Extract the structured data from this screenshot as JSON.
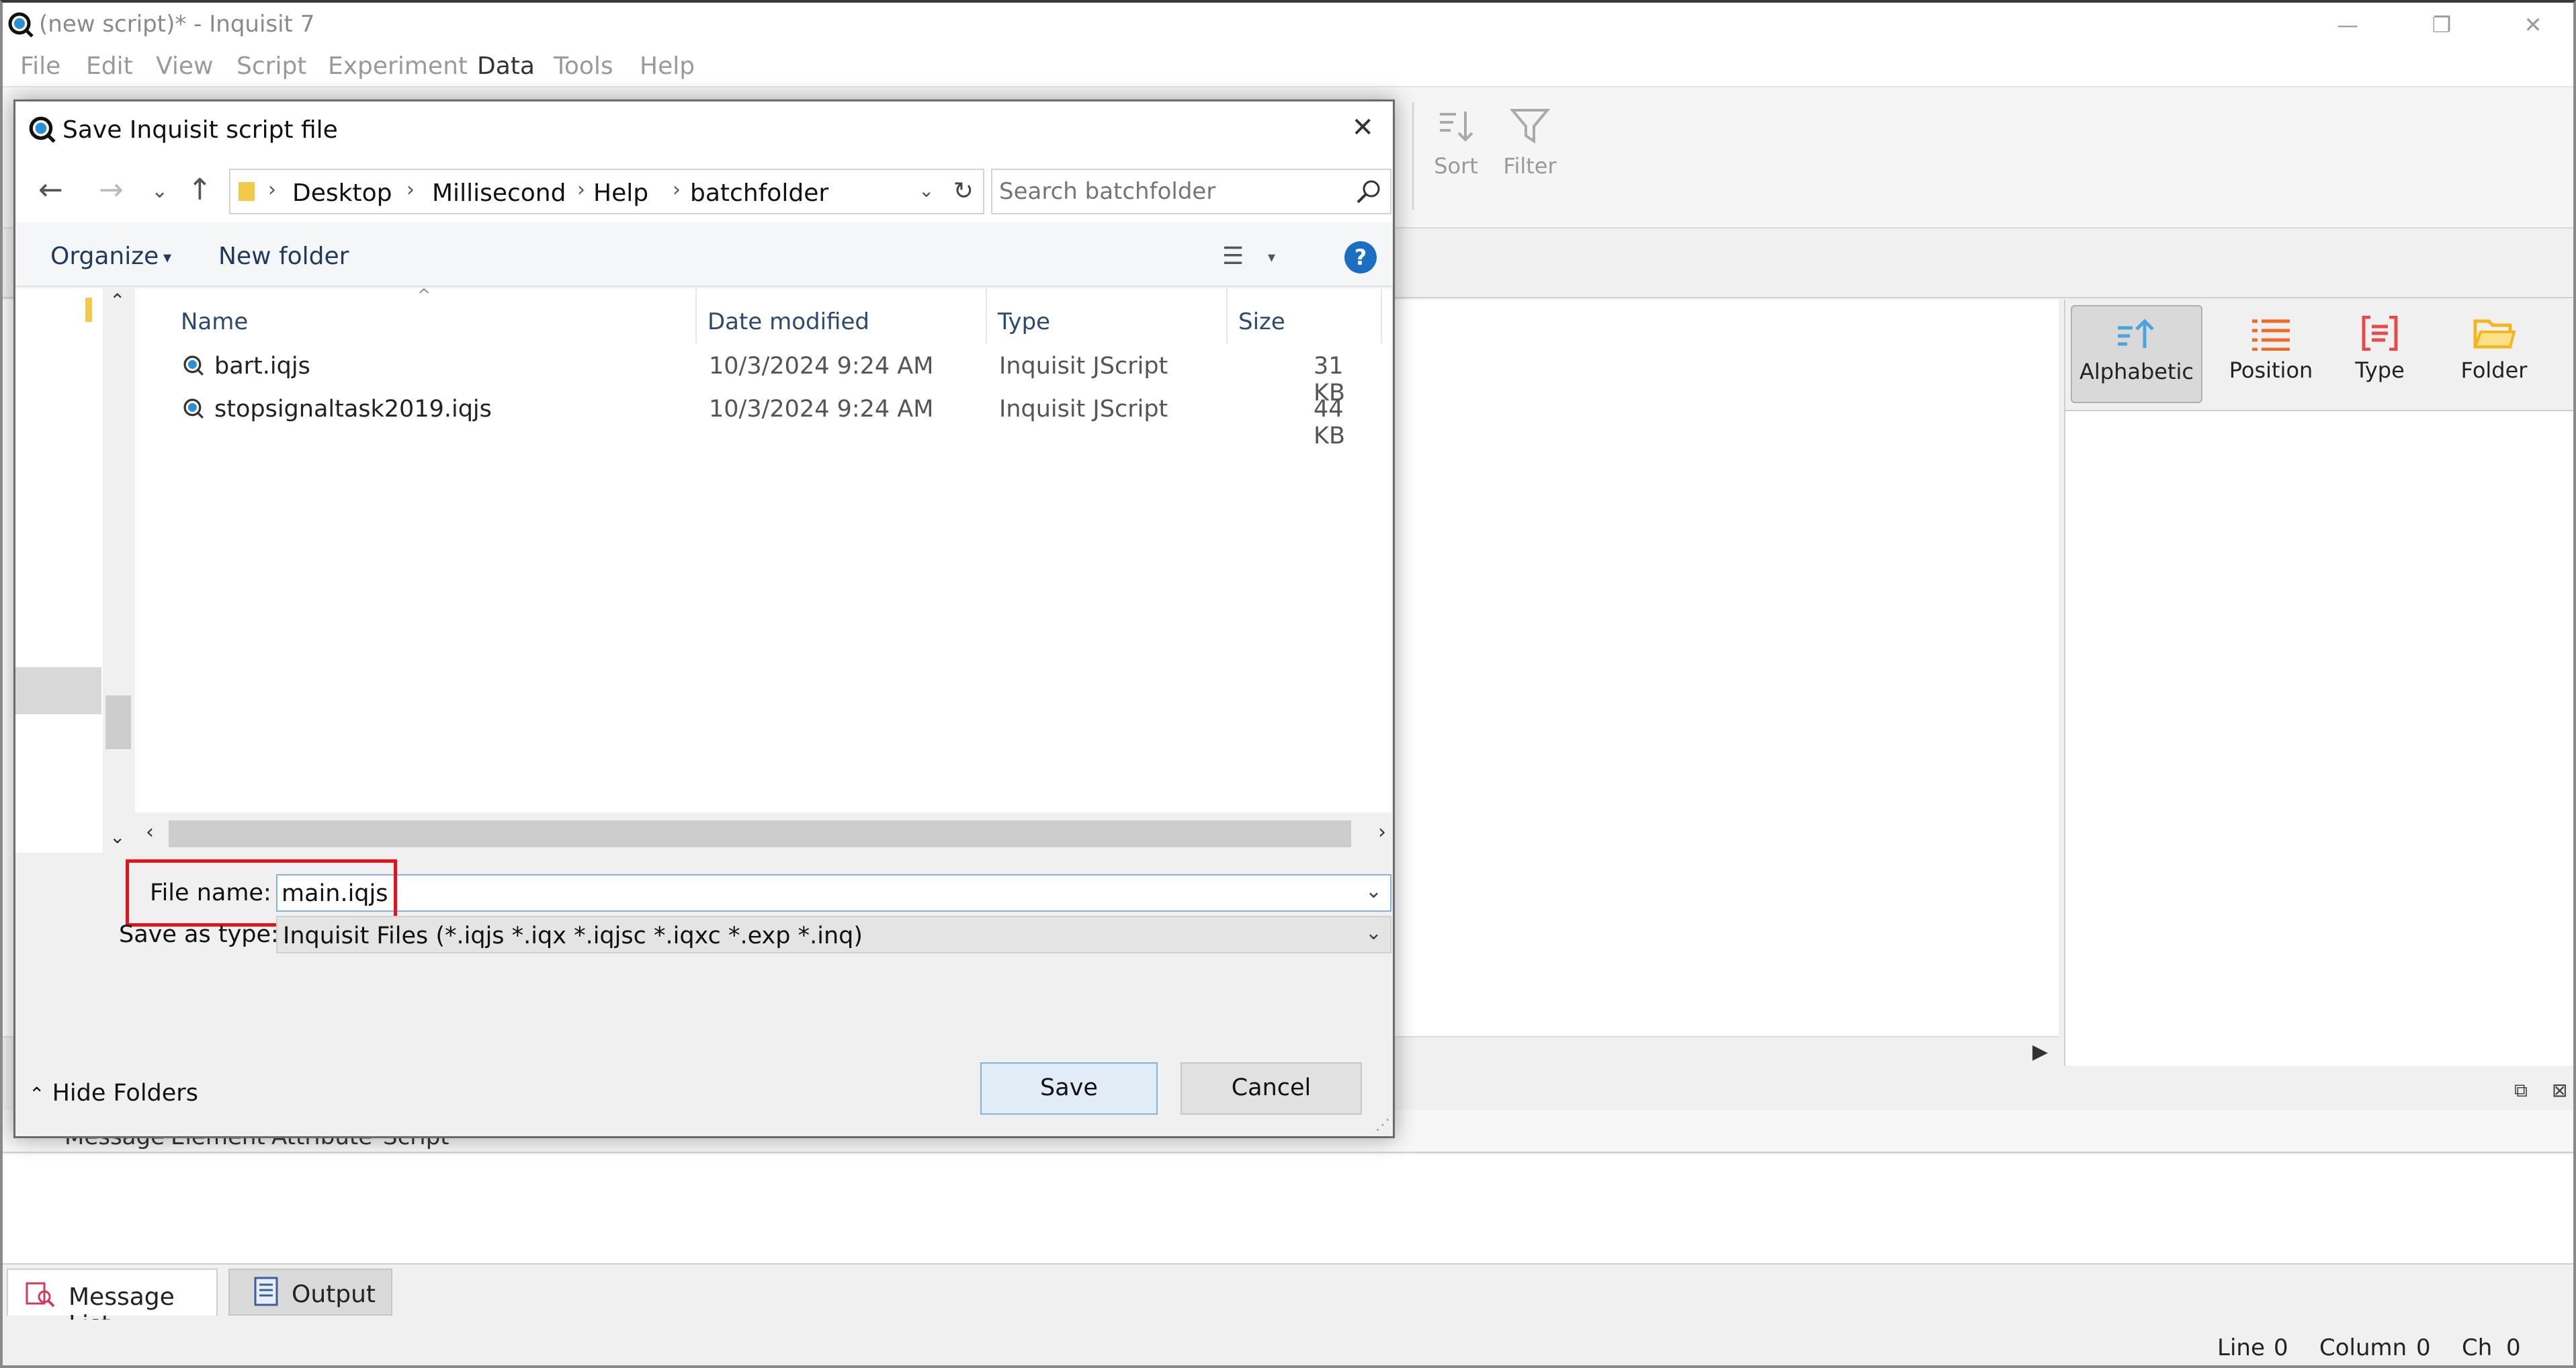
{
  "window": {
    "title": "(new script)* - Inquisit 7",
    "minimize": "—",
    "restore": "❐",
    "close": "✕"
  },
  "menu": [
    "File",
    "Edit",
    "View",
    "Script",
    "Experiment",
    "Data",
    "Tools",
    "Help"
  ],
  "toolbar": {
    "sort": "Sort",
    "filter": "Filter"
  },
  "properties": {
    "alphabetic": "Alphabetic",
    "position": "Position",
    "type": "Type",
    "folder": "Folder"
  },
  "messages": {
    "columns": [
      "Message",
      "Element",
      "Attribute",
      "Script"
    ]
  },
  "bottom_tabs": {
    "message_list": "Message List",
    "output": "Output"
  },
  "status": {
    "line_label": "Line",
    "line": "0",
    "column_label": "Column",
    "column": "0",
    "ch_label": "Ch",
    "ch": "0"
  },
  "dialog": {
    "title": "Save Inquisit script file",
    "close": "✕",
    "breadcrumbs": [
      "Desktop",
      "Millisecond",
      "Help",
      "batchfolder"
    ],
    "search_placeholder": "Search batchfolder",
    "organize": "Organize",
    "new_folder": "New folder",
    "help": "?",
    "columns": {
      "name": "Name",
      "date": "Date modified",
      "type": "Type",
      "size": "Size"
    },
    "files": [
      {
        "name": "bart.iqjs",
        "date": "10/3/2024 9:24 AM",
        "type": "Inquisit JScript",
        "size": "31 KB"
      },
      {
        "name": "stopsignaltask2019.iqjs",
        "date": "10/3/2024 9:24 AM",
        "type": "Inquisit JScript",
        "size": "44 KB"
      }
    ],
    "file_name_label": "File name:",
    "file_name_value": "main.iqjs",
    "save_type_label": "Save as type:",
    "save_type_value": "Inquisit Files (*.iqjs *.iqx *.iqjsc *.iqxc *.exp *.inq)",
    "hide_folders": "Hide Folders",
    "save": "Save",
    "cancel": "Cancel"
  },
  "colors": {
    "accent": "#1b6ec2",
    "highlight": "#e8101a",
    "alphabetic_icon": "#4aa3df",
    "position_icon": "#f06a2a",
    "type_icon": "#e84a4a",
    "folder_icon": "#f3b61f"
  }
}
